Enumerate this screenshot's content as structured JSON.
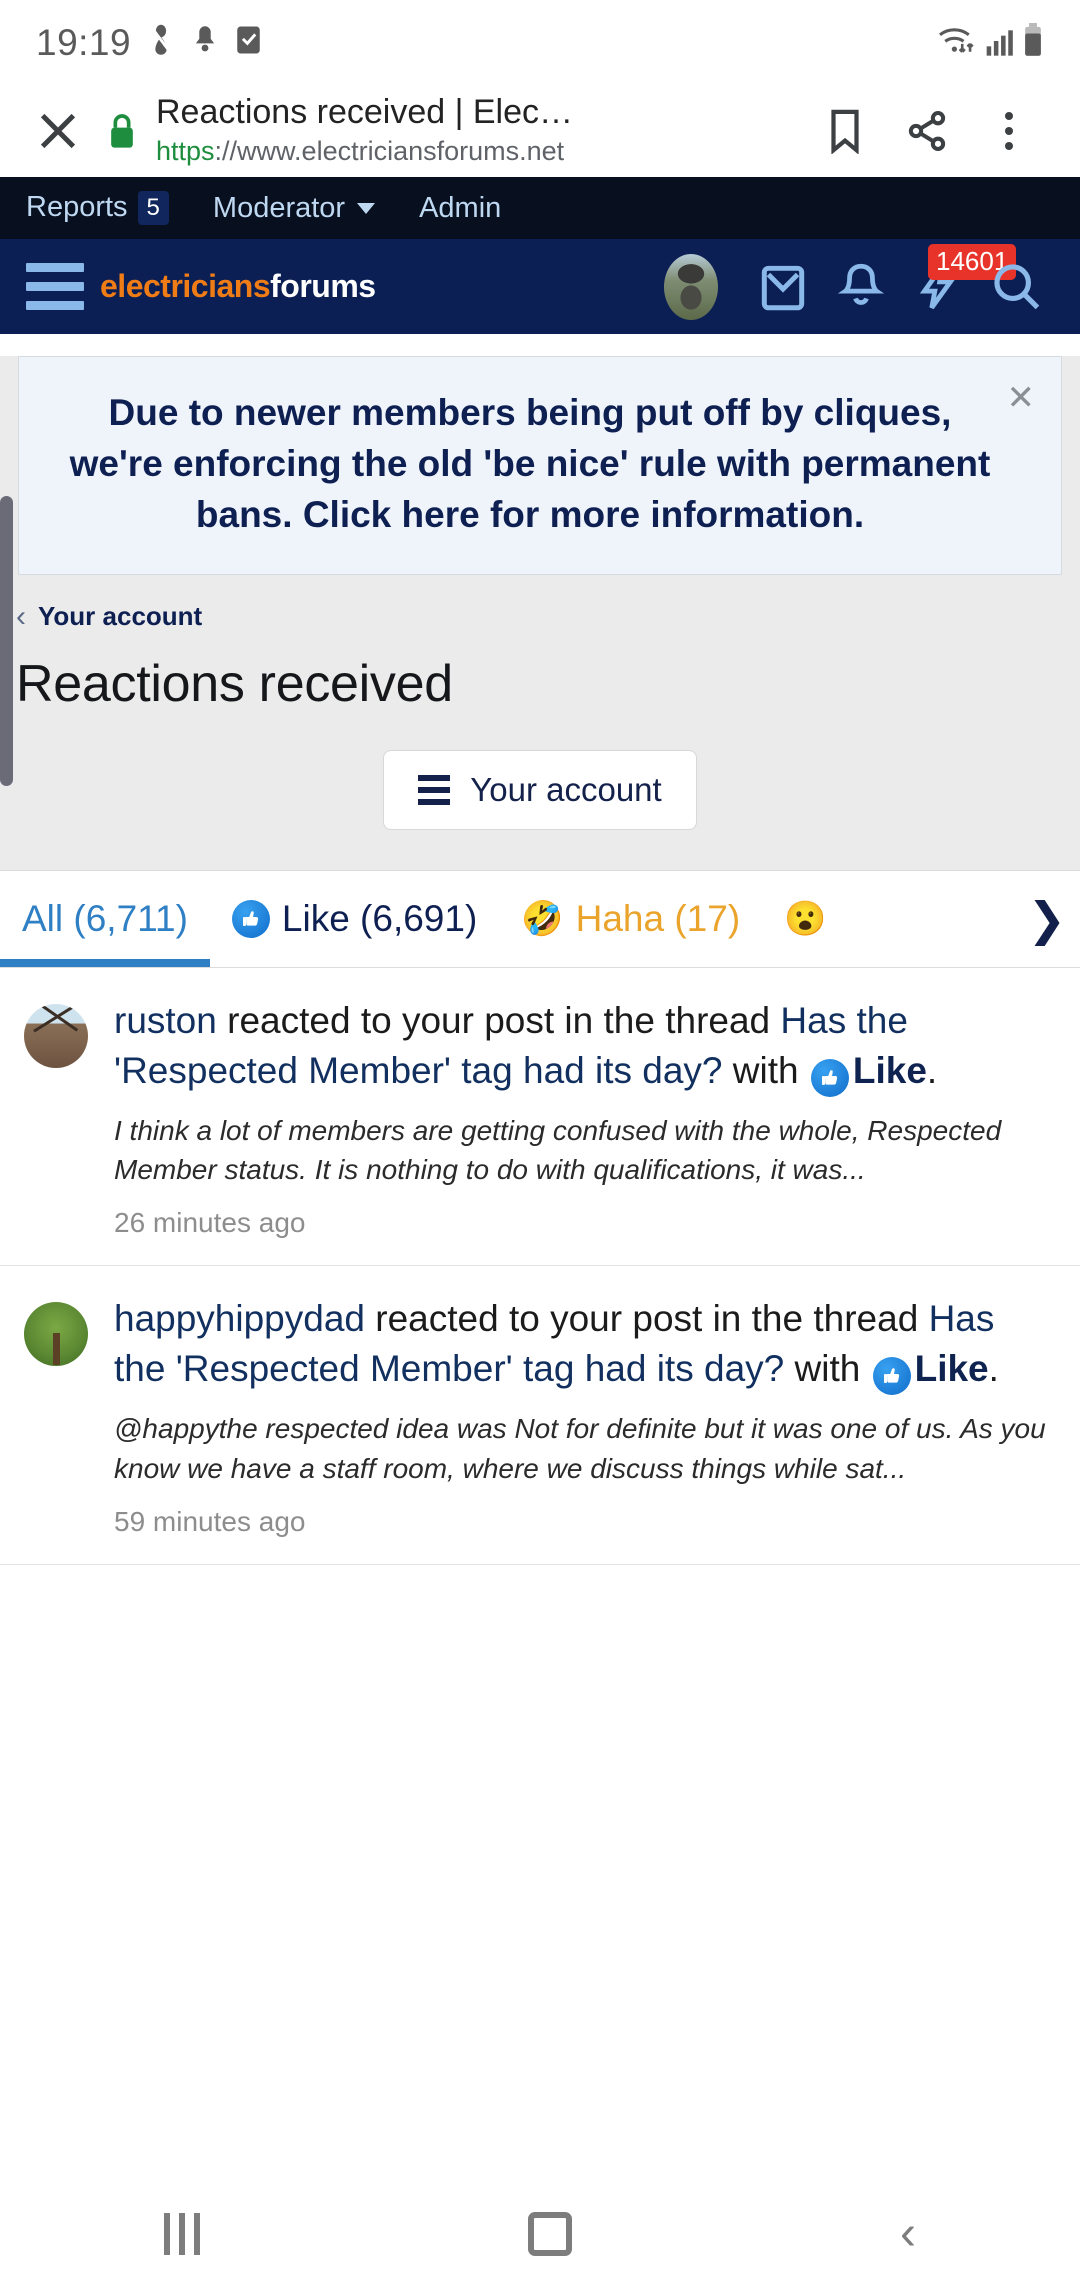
{
  "statusbar": {
    "clock": "19:19",
    "icons": [
      "do-not-disturb-icon",
      "bell-icon",
      "checkbox-icon",
      "wifi-icon",
      "signal-icon",
      "battery-icon"
    ]
  },
  "browser": {
    "close_label": "✕",
    "lock_icon": "lock-icon",
    "page_title": "Reactions received | Elec…",
    "url_scheme": "https",
    "url_rest": "://www.electriciansforums.net",
    "bookmark_icon": "bookmark-icon",
    "share_icon": "share-icon",
    "menu_icon": "more-vertical-icon"
  },
  "adminbar": {
    "items": [
      {
        "label": "Reports",
        "badge": "5"
      },
      {
        "label": "Moderator",
        "caret": true
      },
      {
        "label": "Admin"
      }
    ]
  },
  "siteheader": {
    "menu_icon": "hamburger-icon",
    "logo_part1": "electricians",
    "logo_part2": "forums",
    "avatar": "user-avatar",
    "mail_icon": "mail-icon",
    "bell_icon": "bell-icon",
    "reactions_icon": "reaction-bolt-icon",
    "reactions_badge": "14601",
    "search_icon": "search-icon"
  },
  "notice": {
    "text": "Due to newer members being put off by cliques, we're enforcing the old 'be nice' rule with permanent bans. Click here for more information.",
    "close_label": "✕"
  },
  "breadcrumb": {
    "chevron": "‹",
    "label": "Your account"
  },
  "page": {
    "title": "Reactions received",
    "account_button": "Your account"
  },
  "tabs": [
    {
      "label": "All (6,711)",
      "icon": "",
      "active": true
    },
    {
      "label": "Like (6,691)",
      "icon": "thumbs-up-icon",
      "active": false
    },
    {
      "label": "Haha (17)",
      "icon": "🤣",
      "active": false
    },
    {
      "label": "",
      "icon": "😮",
      "active": false
    }
  ],
  "tabs_next_icon": "❯",
  "reactions": [
    {
      "avatar": "crane-avatar",
      "username": "ruston",
      "action_pre": " reacted to your post in the thread ",
      "thread": "Has the 'Respected Member' tag had its day?",
      "action_mid": " with ",
      "reaction": "Like",
      "period": ".",
      "snippet": "I think a lot of members are getting confused with the whole, Respected Member status. It is nothing to do with qualifications, it was...",
      "time": "26 minutes ago"
    },
    {
      "avatar": "tree-avatar",
      "username": "happyhippydad",
      "action_pre": " reacted to your post in the thread ",
      "thread": "Has the 'Respected Member' tag had its day?",
      "action_mid": " with ",
      "reaction": "Like",
      "period": ".",
      "snippet": "@happythe respected idea was Not for definite but it was one of us. As you know we have a staff room, where we discuss things while sat...",
      "time": "59 minutes ago"
    }
  ],
  "navbar": {
    "recents_icon": "recents-icon",
    "home_icon": "home-icon",
    "back_icon": "back-icon"
  },
  "colors": {
    "header_navy": "#0b1f54",
    "admin_black": "#080f1e",
    "logo_orange": "#f07c16",
    "badge_red": "#e8332a",
    "tab_active_blue": "#2f7fc4",
    "haha_amber": "#eaa42b",
    "link_navy": "#12305f",
    "lock_green": "#1e8e3e"
  }
}
